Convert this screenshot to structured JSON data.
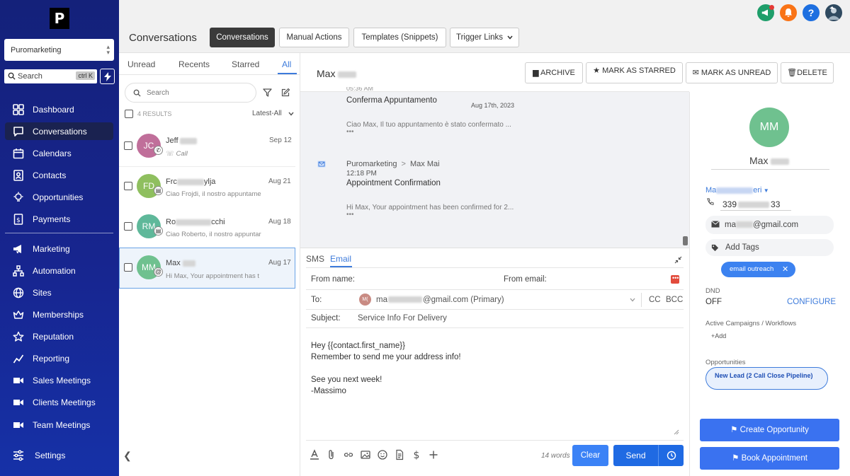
{
  "sidebar": {
    "logo": "P",
    "account": "Puromarketing",
    "search_label": "Search",
    "search_shortcut": "ctrl K",
    "nav": [
      {
        "label": "Dashboard",
        "icon": "dashboard-icon"
      },
      {
        "label": "Conversations",
        "icon": "chat-icon"
      },
      {
        "label": "Calendars",
        "icon": "calendar-icon"
      },
      {
        "label": "Contacts",
        "icon": "contacts-icon"
      },
      {
        "label": "Opportunities",
        "icon": "opportunities-icon"
      },
      {
        "label": "Payments",
        "icon": "payments-icon"
      },
      {
        "label": "Marketing",
        "icon": "megaphone-icon"
      },
      {
        "label": "Automation",
        "icon": "automation-icon"
      },
      {
        "label": "Sites",
        "icon": "globe-icon"
      },
      {
        "label": "Memberships",
        "icon": "memberships-icon"
      },
      {
        "label": "Reputation",
        "icon": "reputation-icon"
      },
      {
        "label": "Reporting",
        "icon": "reporting-icon"
      },
      {
        "label": "Sales Meetings",
        "icon": "video-icon"
      },
      {
        "label": "Clients Meetings",
        "icon": "video-icon"
      },
      {
        "label": "Team Meetings",
        "icon": "video-icon"
      }
    ],
    "active_index": 1,
    "settings": "Settings"
  },
  "topbar": {
    "icons": [
      "megaphone-icon",
      "bell-icon",
      "help-icon",
      "user-avatar"
    ],
    "colors": {
      "megaphone": "#1e9e6a",
      "bell": "#f97316",
      "help": "#1d6fe0"
    }
  },
  "header": {
    "title": "Conversations",
    "tabs": [
      "Conversations",
      "Manual Actions",
      "Templates (Snippets)",
      "Trigger Links"
    ]
  },
  "list": {
    "tabs": [
      "Unread",
      "Recents",
      "Starred",
      "All"
    ],
    "active_tab": "All",
    "search_placeholder": "Search",
    "results": "4 RESULTS",
    "sort": "Latest-All",
    "items": [
      {
        "initials": "JC",
        "color": "#c06f9a",
        "name_start": "Jeff",
        "date": "Sep 12",
        "preview": "Call",
        "type": "call"
      },
      {
        "initials": "FD",
        "color": "#8fbf5f",
        "name_start": "Frc",
        "name_end": "ylja",
        "date": "Aug 21",
        "preview": "Ciao Frojdi, il nostro appuntame",
        "type": "sms"
      },
      {
        "initials": "RM",
        "color": "#5fb89a",
        "name_start": "Ro",
        "name_end": "cchi",
        "date": "Aug 18",
        "preview": "Ciao Roberto, il nostro appuntar",
        "type": "sms"
      },
      {
        "initials": "MM",
        "color": "#6fc18f",
        "name_start": "Max",
        "date": "Aug 17",
        "preview": "Hi Max, Your appointment has t",
        "type": "email"
      }
    ]
  },
  "chat": {
    "contact_name": "Max",
    "actions": [
      "ARCHIVE",
      "MARK AS STARRED",
      "MARK AS UNREAD",
      "DELETE"
    ],
    "thread": [
      {
        "time_partial": "05:36 AM",
        "title": "Conferma Appuntamento",
        "date": "Aug 17th, 2023",
        "body": "Ciao Max, Il tuo appuntamento è stato confermato ..."
      },
      {
        "from": "Puromarketing",
        "to": "Max Mai",
        "time": "12:18 PM",
        "title": "Appointment Confirmation",
        "body": "Hi Max, Your appointment has been confirmed for 2..."
      }
    ]
  },
  "composer": {
    "tabs": [
      "SMS",
      "Email"
    ],
    "active_tab": "Email",
    "from_name_label": "From name:",
    "from_email_label": "From email:",
    "to_label": "To:",
    "to_avatar": "M(",
    "to_value_start": "ma",
    "to_value_end": "@gmail.com (Primary)",
    "cc": "CC",
    "bcc": "BCC",
    "subject_label": "Subject:",
    "subject_value": "Service Info For Delivery",
    "body_lines": [
      "Hey {{contact.first_name}}",
      "Remember to send me your address info!",
      "",
      "See you next week!",
      "-Massimo"
    ],
    "word_count": "14 words",
    "clear": "Clear",
    "send": "Send"
  },
  "contact": {
    "initials": "MM",
    "name": "Max",
    "owner_start": "Ma",
    "owner_end": "eri",
    "phone_start": "339",
    "phone_end": "33",
    "email_start": "ma",
    "email_end": "@gmail.com",
    "add_tags": "Add Tags",
    "tag": "email outreach",
    "dnd_label": "DND",
    "dnd_value": "OFF",
    "configure": "CONFIGURE",
    "campaigns_label": "Active Campaigns / Workflows",
    "add": "Add",
    "opportunities_label": "Opportunities",
    "opportunity": "New Lead (2 Call Close Pipeline)",
    "create_opportunity": "Create Opportunity",
    "book_appointment": "Book Appointment"
  }
}
